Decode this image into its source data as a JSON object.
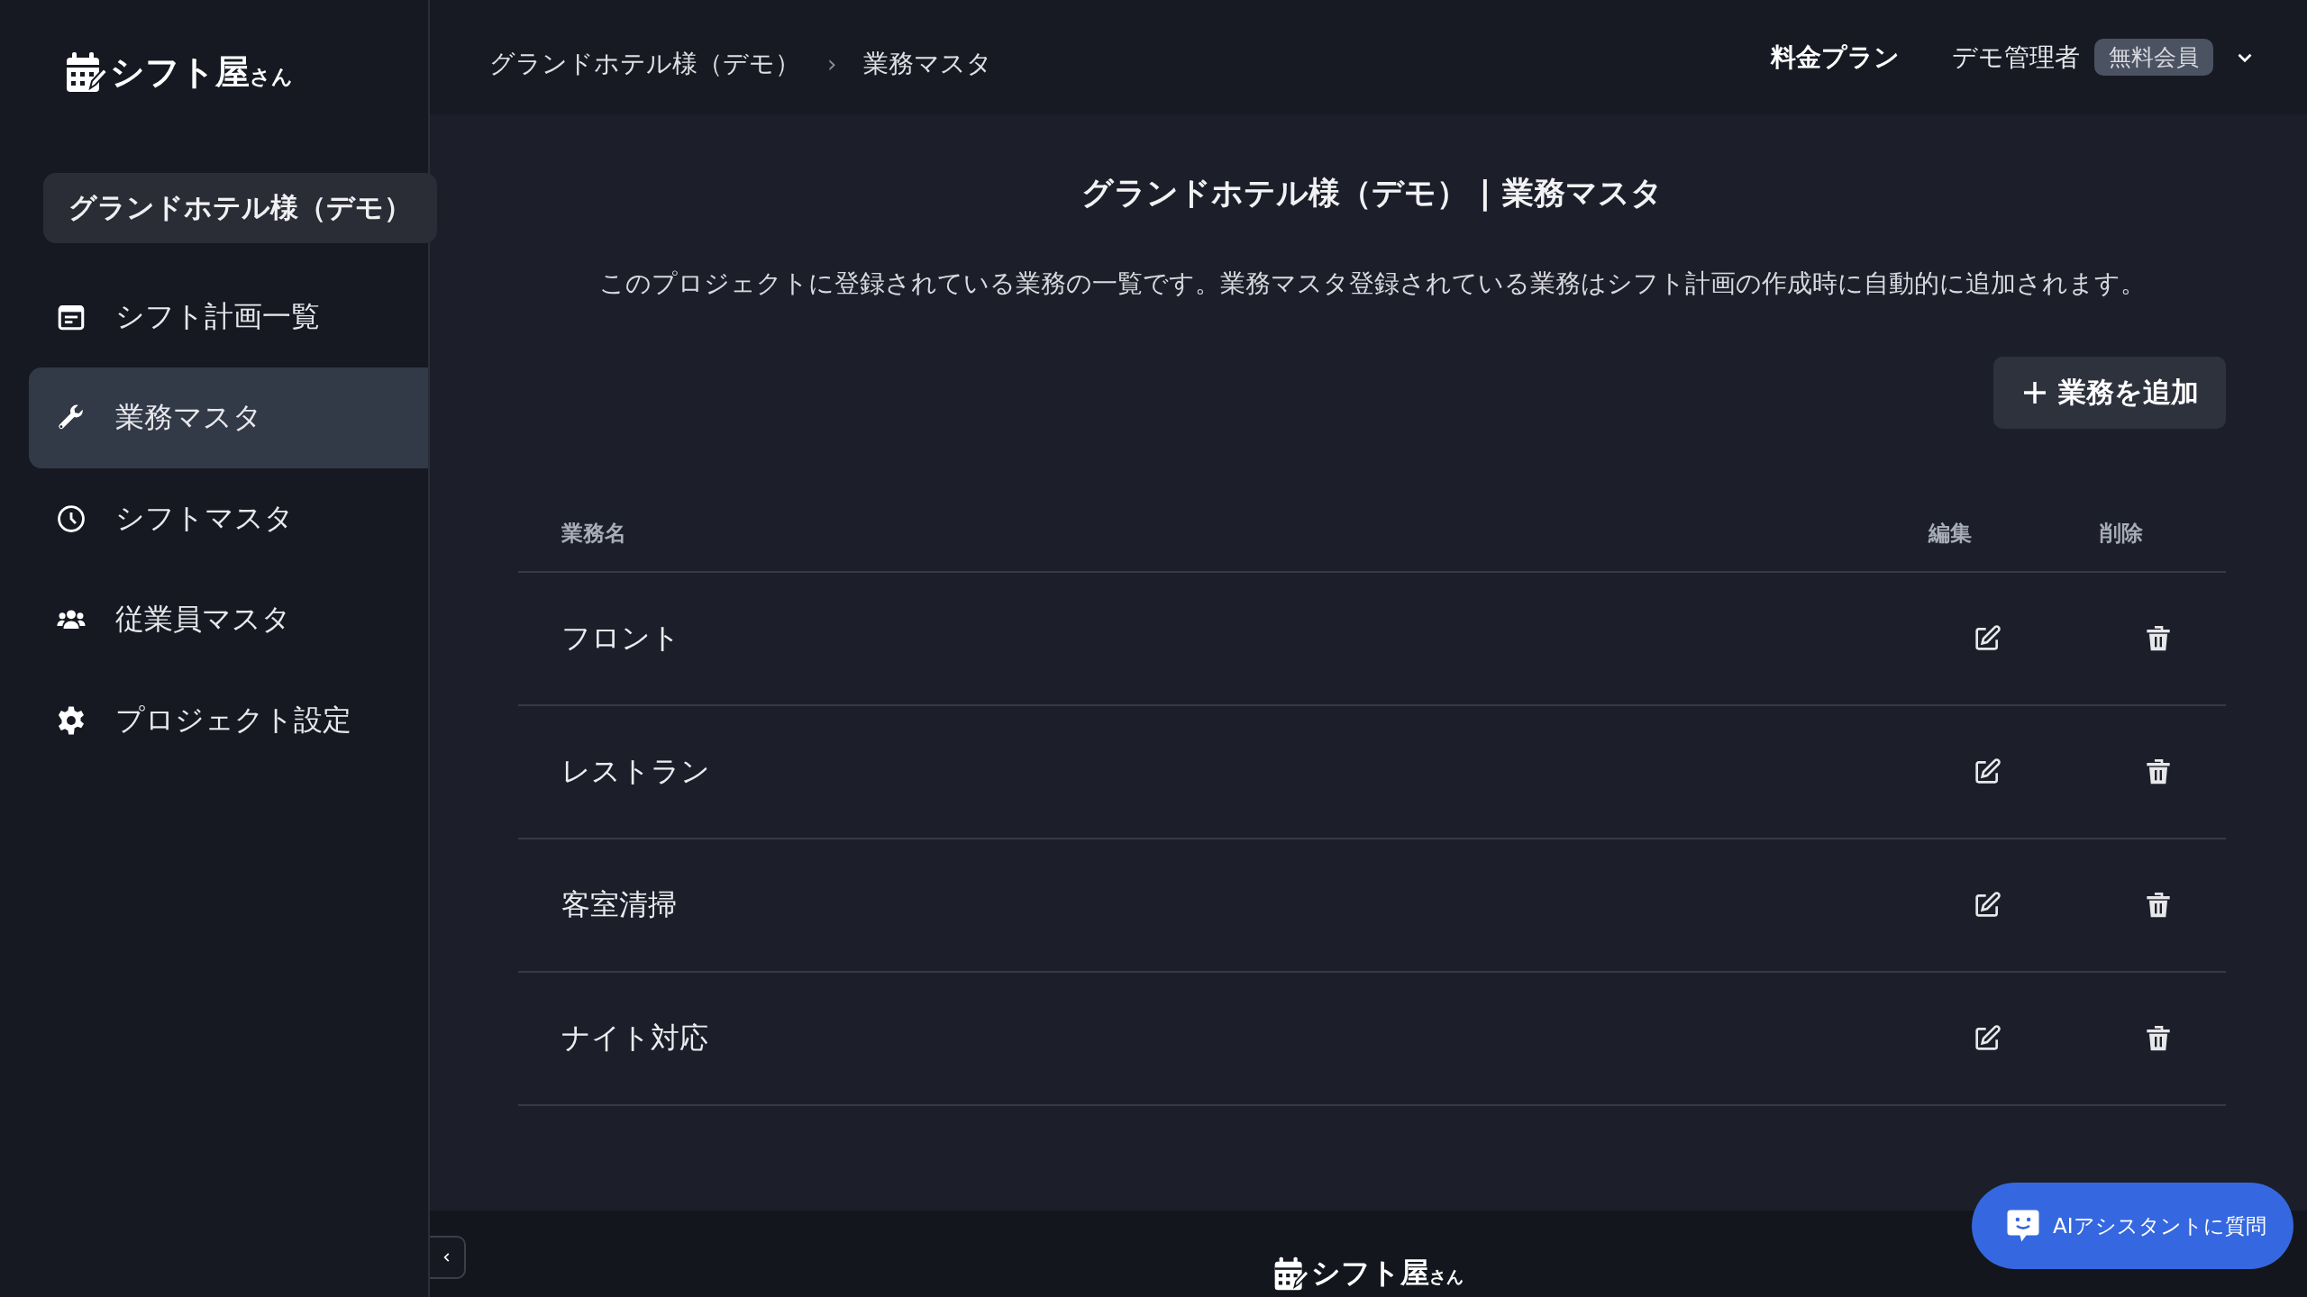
{
  "logo": {
    "text": "シフト屋$_{さん}$"
  },
  "sidebar": {
    "project": "グランドホテル様（デモ）",
    "items": [
      {
        "label": "シフト計画一覧",
        "selected": false
      },
      {
        "label": "業務マスタ",
        "selected": true
      },
      {
        "label": "シフトマスタ",
        "selected": false
      },
      {
        "label": "従業員マスタ",
        "selected": false
      },
      {
        "label": "プロジェクト設定",
        "selected": false
      }
    ]
  },
  "header": {
    "breadcrumb": [
      "グランドホテル様（デモ）",
      "業務マスタ"
    ],
    "separator": "›",
    "plan_link": "料金プラン",
    "user": "デモ管理者",
    "badge": "無料会員"
  },
  "page": {
    "title": "グランドホテル様（デモ） | 業務マスタ",
    "description": "このプロジェクトに登録されている業務の一覧です。業務マスタ登録されている業務はシフト計画の作成時に自動的に追加されます。",
    "add_button": "業務を追加"
  },
  "table": {
    "columns": [
      "業務名",
      "編集",
      "削除"
    ],
    "rows": [
      {
        "name": "フロント"
      },
      {
        "name": "レストラン"
      },
      {
        "name": "客室清掃"
      },
      {
        "name": "ナイト対応"
      }
    ]
  },
  "footer": {
    "logo": "シフト屋$_{さん}$"
  },
  "ai_button": "AIアシスタントに質問"
}
